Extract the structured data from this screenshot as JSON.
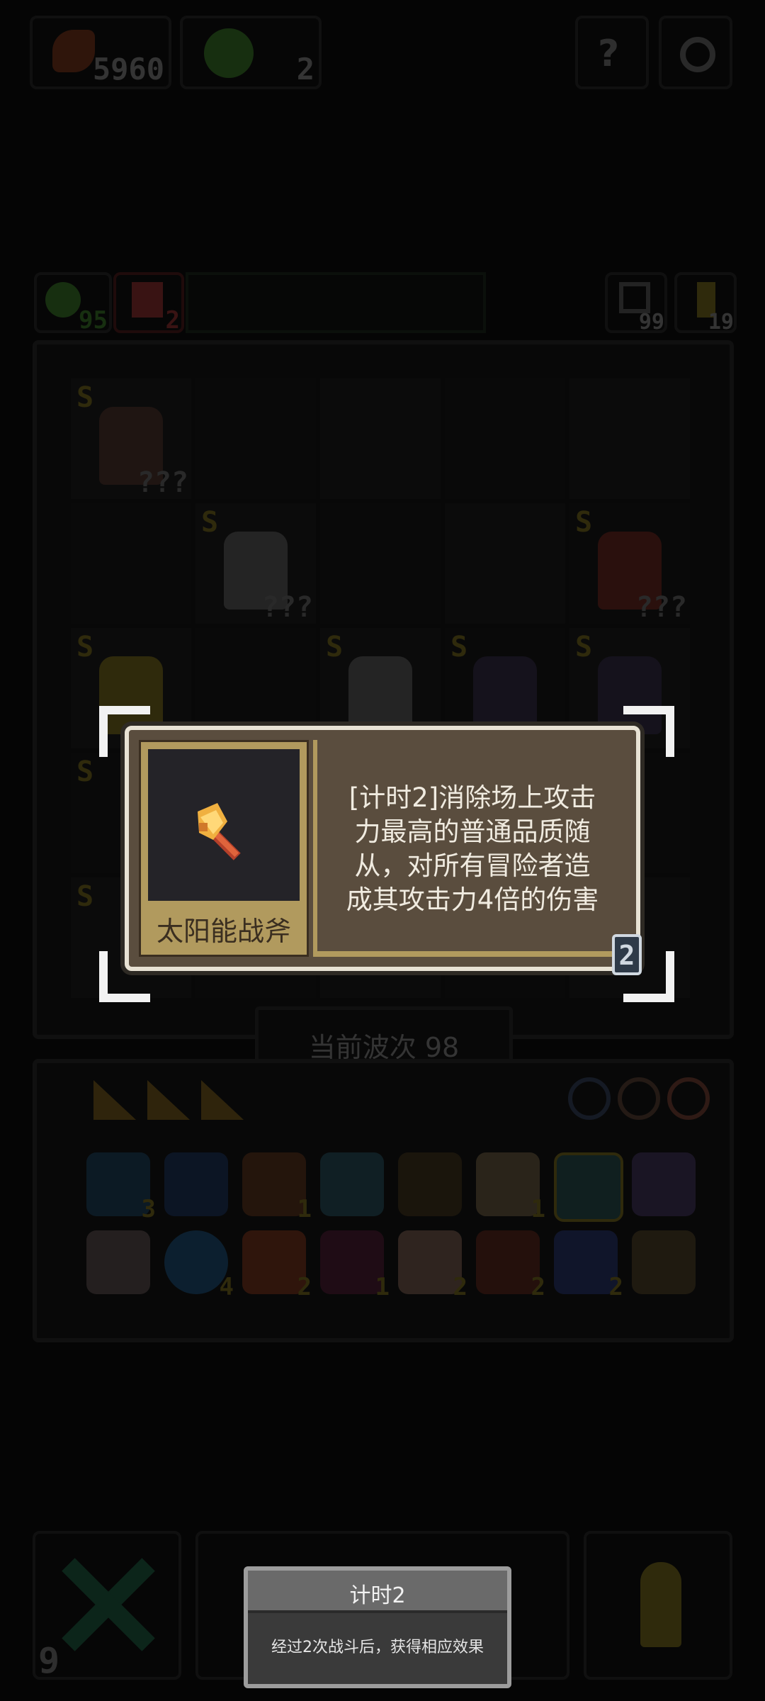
{
  "currency": {
    "gold": "5960",
    "gems": "2"
  },
  "stats": {
    "left_a": "95",
    "left_b": "2",
    "right_a": "99",
    "right_b": "19"
  },
  "grid_labels": {
    "rank": "S",
    "unknown": "???"
  },
  "wave": {
    "label": "当前波次 98"
  },
  "inventory": {
    "row1_counts": [
      "3",
      "",
      "1",
      "",
      "",
      "1",
      "",
      ""
    ],
    "row2_counts": [
      "",
      "4",
      "2",
      "1",
      "2",
      "2",
      "2",
      ""
    ]
  },
  "card": {
    "item_name": "太阳能战斧",
    "description": "[计时2]消除场上攻击\n力最高的普通品质随\n从，对所有冒险者造\n成其攻击力4倍的伤害",
    "tier_badge": "2"
  },
  "bottom": {
    "count": "9"
  },
  "tooltip": {
    "title": "计时2",
    "text": "经过2次战斗后，获得相应效果"
  },
  "colors": {
    "card_bg": "#5a4d3e",
    "card_gold": "#b19a5e",
    "card_border": "#e8e2d4",
    "accent_green": "#1e6b4a"
  }
}
